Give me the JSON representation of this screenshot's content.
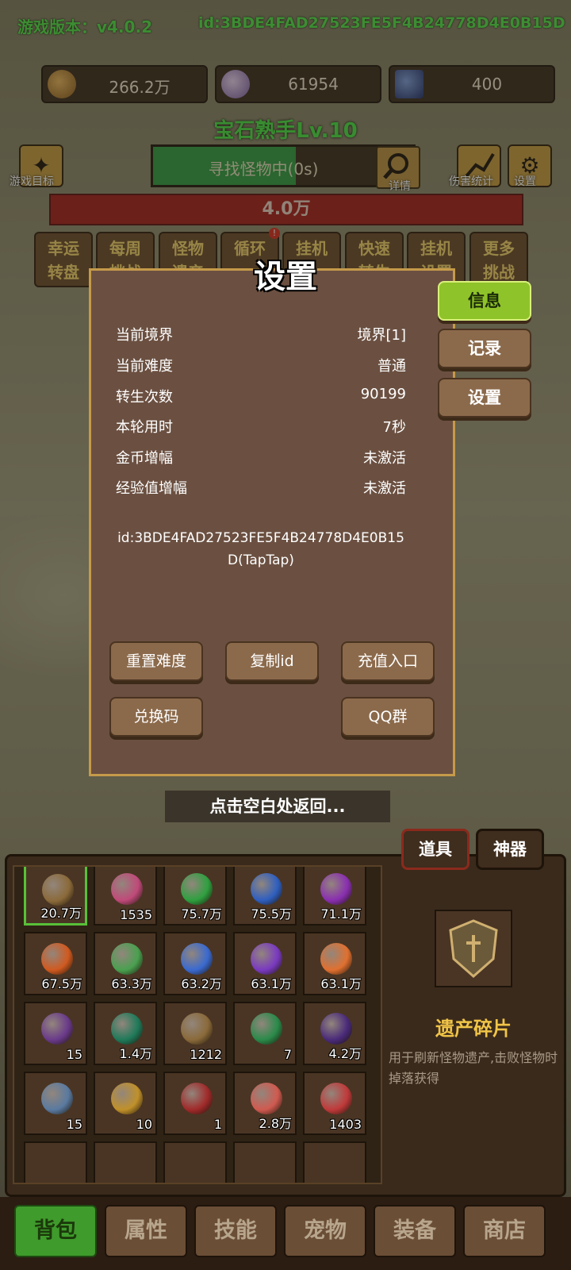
{
  "header": {
    "version": "游戏版本：v4.0.2",
    "id": "id:3BDE4FAD27523FE5F4B24778D4E0B15D"
  },
  "resources": [
    {
      "icon": "gold-coin-icon",
      "value": "266.2万"
    },
    {
      "icon": "crystal-icon",
      "value": "61954"
    },
    {
      "icon": "card-icon",
      "value": "400"
    }
  ],
  "player_title": "宝石熟手Lv.10",
  "search": {
    "status": "寻找怪物中(0s)",
    "progress": 0.55,
    "detail_label": "详情"
  },
  "left_icon_label": "游戏目标",
  "right_icons": {
    "damage_label": "伤害统计",
    "settings_label": "设置"
  },
  "enemy_hp": "4.0万",
  "menu": [
    {
      "l1": "幸运",
      "l2": "转盘"
    },
    {
      "l1": "每周",
      "l2": "挑战"
    },
    {
      "l1": "怪物",
      "l2": "遗产"
    },
    {
      "l1": "循环",
      "l2": ""
    },
    {
      "l1": "挂机",
      "l2": ""
    },
    {
      "l1": "快速",
      "l2": "转生"
    },
    {
      "l1": "挂机",
      "l2": "设置"
    },
    {
      "l1": "更多",
      "l2": "挑战"
    }
  ],
  "menu_badge": "!",
  "dialog": {
    "title": "设置",
    "rows": [
      {
        "key": "当前境界",
        "value": "境界[1]"
      },
      {
        "key": "当前难度",
        "value": "普通"
      },
      {
        "key": "转生次数",
        "value": "90199"
      },
      {
        "key": "本轮用时",
        "value": "7秒"
      },
      {
        "key": "金币增幅",
        "value": "未激活"
      },
      {
        "key": "经验值增幅",
        "value": "未激活"
      }
    ],
    "id_text": "id:3BDE4FAD27523FE5F4B24778D4E0B15D(TapTap)",
    "buttons": {
      "reset": "重置难度",
      "copy": "复制id",
      "recharge": "充值入口",
      "redeem": "兑换码",
      "qq": "QQ群"
    },
    "tabs": [
      "信息",
      "记录",
      "设置"
    ]
  },
  "hint": "点击空白处返回...",
  "panel_tabs": [
    "道具",
    "神器"
  ],
  "inventory": [
    {
      "count": "20.7万",
      "color": "#8b6a3a"
    },
    {
      "count": "1535",
      "color": "#c04a7a"
    },
    {
      "count": "75.7万",
      "color": "#2fa040"
    },
    {
      "count": "75.5万",
      "color": "#2f5fc0"
    },
    {
      "count": "71.1万",
      "color": "#8a2fb0"
    },
    {
      "count": "67.5万",
      "color": "#d05a20"
    },
    {
      "count": "63.3万",
      "color": "#4aa050"
    },
    {
      "count": "63.2万",
      "color": "#3a6ad0"
    },
    {
      "count": "63.1万",
      "color": "#7a3ac0"
    },
    {
      "count": "63.1万",
      "color": "#e07030"
    },
    {
      "count": "15",
      "color": "#6a3a8a"
    },
    {
      "count": "1.4万",
      "color": "#1f7a5a"
    },
    {
      "count": "1212",
      "color": "#8a6a3a"
    },
    {
      "count": "7",
      "color": "#2a8a4a"
    },
    {
      "count": "4.2万",
      "color": "#4a2a7a"
    },
    {
      "count": "15",
      "color": "#5a7aa0"
    },
    {
      "count": "10",
      "color": "#c0902a"
    },
    {
      "count": "1",
      "color": "#a02a2a"
    },
    {
      "count": "2.8万",
      "color": "#d05a50"
    },
    {
      "count": "1403",
      "color": "#c03a3a"
    }
  ],
  "detail": {
    "name": "遗产碎片",
    "desc": "用于刷新怪物遗产,击败怪物时掉落获得"
  },
  "nav": [
    "背包",
    "属性",
    "技能",
    "宠物",
    "装备",
    "商店"
  ]
}
